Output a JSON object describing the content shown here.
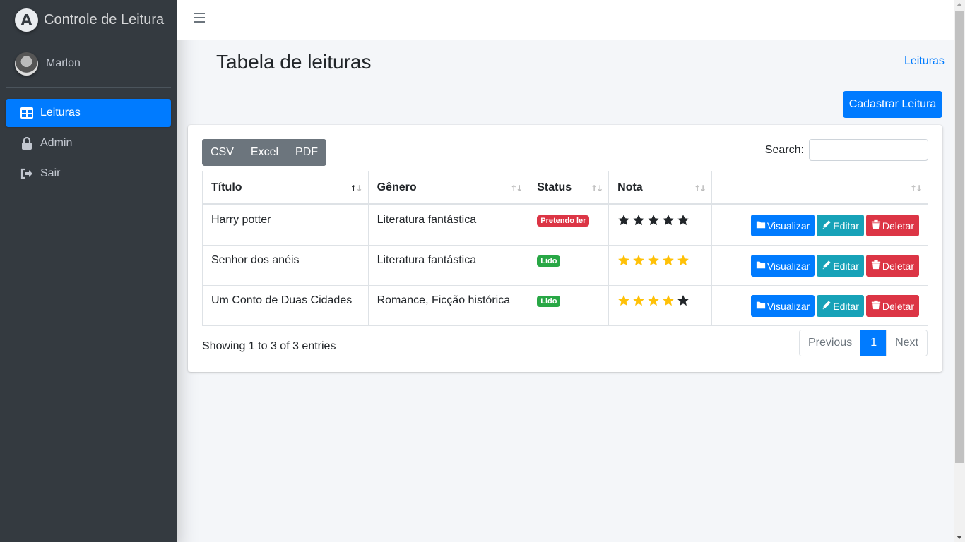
{
  "brand": {
    "logo_letter": "A",
    "name": "Controle de Leitura"
  },
  "user": {
    "name": "Marlon"
  },
  "sidebar": {
    "items": [
      {
        "label": "Leituras",
        "icon": "table-icon",
        "active": true
      },
      {
        "label": "Admin",
        "icon": "lock-icon",
        "active": false
      },
      {
        "label": "Sair",
        "icon": "sign-out-icon",
        "active": false
      }
    ]
  },
  "header": {
    "title": "Tabela de leituras",
    "breadcrumb": "Leituras",
    "new_button": "Cadastrar Leitura"
  },
  "export": {
    "csv": "CSV",
    "excel": "Excel",
    "pdf": "PDF"
  },
  "search": {
    "label": "Search:",
    "value": ""
  },
  "table": {
    "columns": [
      "Título",
      "Gênero",
      "Status",
      "Nota",
      ""
    ],
    "rows": [
      {
        "titulo": "Harry potter",
        "genero": "Literatura fantástica",
        "status": "Pretendo ler",
        "status_color": "#dc3545",
        "stars_rated": 0,
        "stars_total": 5
      },
      {
        "titulo": "Senhor dos anéis",
        "genero": "Literatura fantástica",
        "status": "Lido",
        "status_color": "#28a745",
        "stars_rated": 5,
        "stars_total": 5
      },
      {
        "titulo": "Um Conto de Duas Cidades",
        "genero": "Romance, Ficção histórica",
        "status": "Lido",
        "status_color": "#28a745",
        "stars_rated": 4,
        "stars_total": 5
      }
    ],
    "actions": {
      "view": "Visualizar",
      "edit": "Editar",
      "delete": "Deletar"
    }
  },
  "footer": {
    "info": "Showing 1 to 3 of 3 entries",
    "previous": "Previous",
    "current_page": "1",
    "next": "Next"
  },
  "colors": {
    "primary": "#007bff",
    "info": "#17a2b8",
    "danger": "#dc3545",
    "success": "#28a745",
    "star_filled": "#ffc107",
    "star_empty": "#212529",
    "sidebar": "#343a40"
  }
}
